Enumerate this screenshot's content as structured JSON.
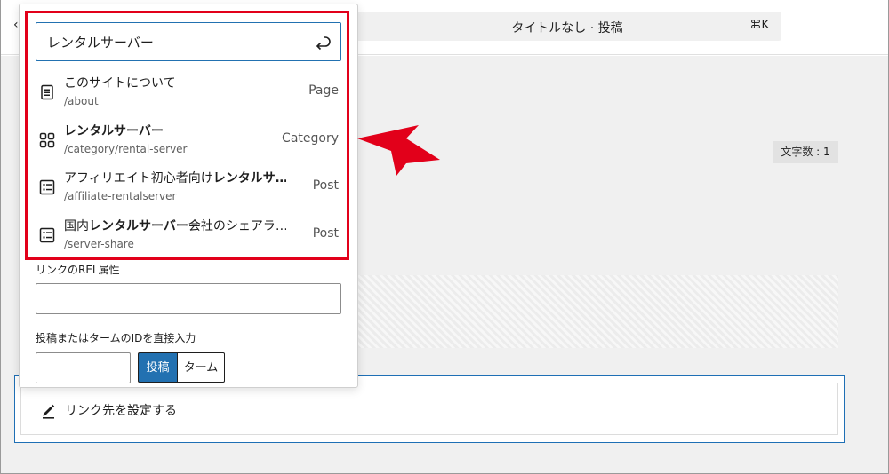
{
  "editor": {
    "back_glyph": "‹",
    "command_bar": {
      "title": "タイトルなし · 投稿",
      "shortcut": "⌘K"
    },
    "word_count": "文字数 : 1",
    "link_block": {
      "label": "リンク先を設定する",
      "icon": "pencil-icon"
    }
  },
  "popover": {
    "search": {
      "value": "レンタルサーバー",
      "icon": "return-icon"
    },
    "results": [
      {
        "title_pre": "このサイトについて",
        "title_bold": "",
        "title_post": "",
        "url": "/about",
        "type": "Page",
        "icon": "page-icon"
      },
      {
        "title_pre": "",
        "title_bold": "レンタルサーバー",
        "title_post": "",
        "url": "/category/rental-server",
        "type": "Category",
        "icon": "category-icon"
      },
      {
        "title_pre": "アフィリエイト初心者向け",
        "title_bold": "レンタルサ…",
        "title_post": "",
        "url": "/affiliate-rentalserver",
        "type": "Post",
        "icon": "post-icon"
      },
      {
        "title_pre": "国内",
        "title_bold": "レンタルサーバー",
        "title_post": "会社のシェアラ…",
        "url": "/server-share",
        "type": "Post",
        "icon": "post-icon"
      }
    ],
    "rel_label": "リンクのREL属性",
    "rel_value": "",
    "id_label": "投稿またはタームのIDを直接入力",
    "id_value": "",
    "segments": {
      "post": "投稿",
      "term": "ターム"
    }
  },
  "colors": {
    "accent": "#2271b1",
    "highlight": "#e2001a"
  }
}
